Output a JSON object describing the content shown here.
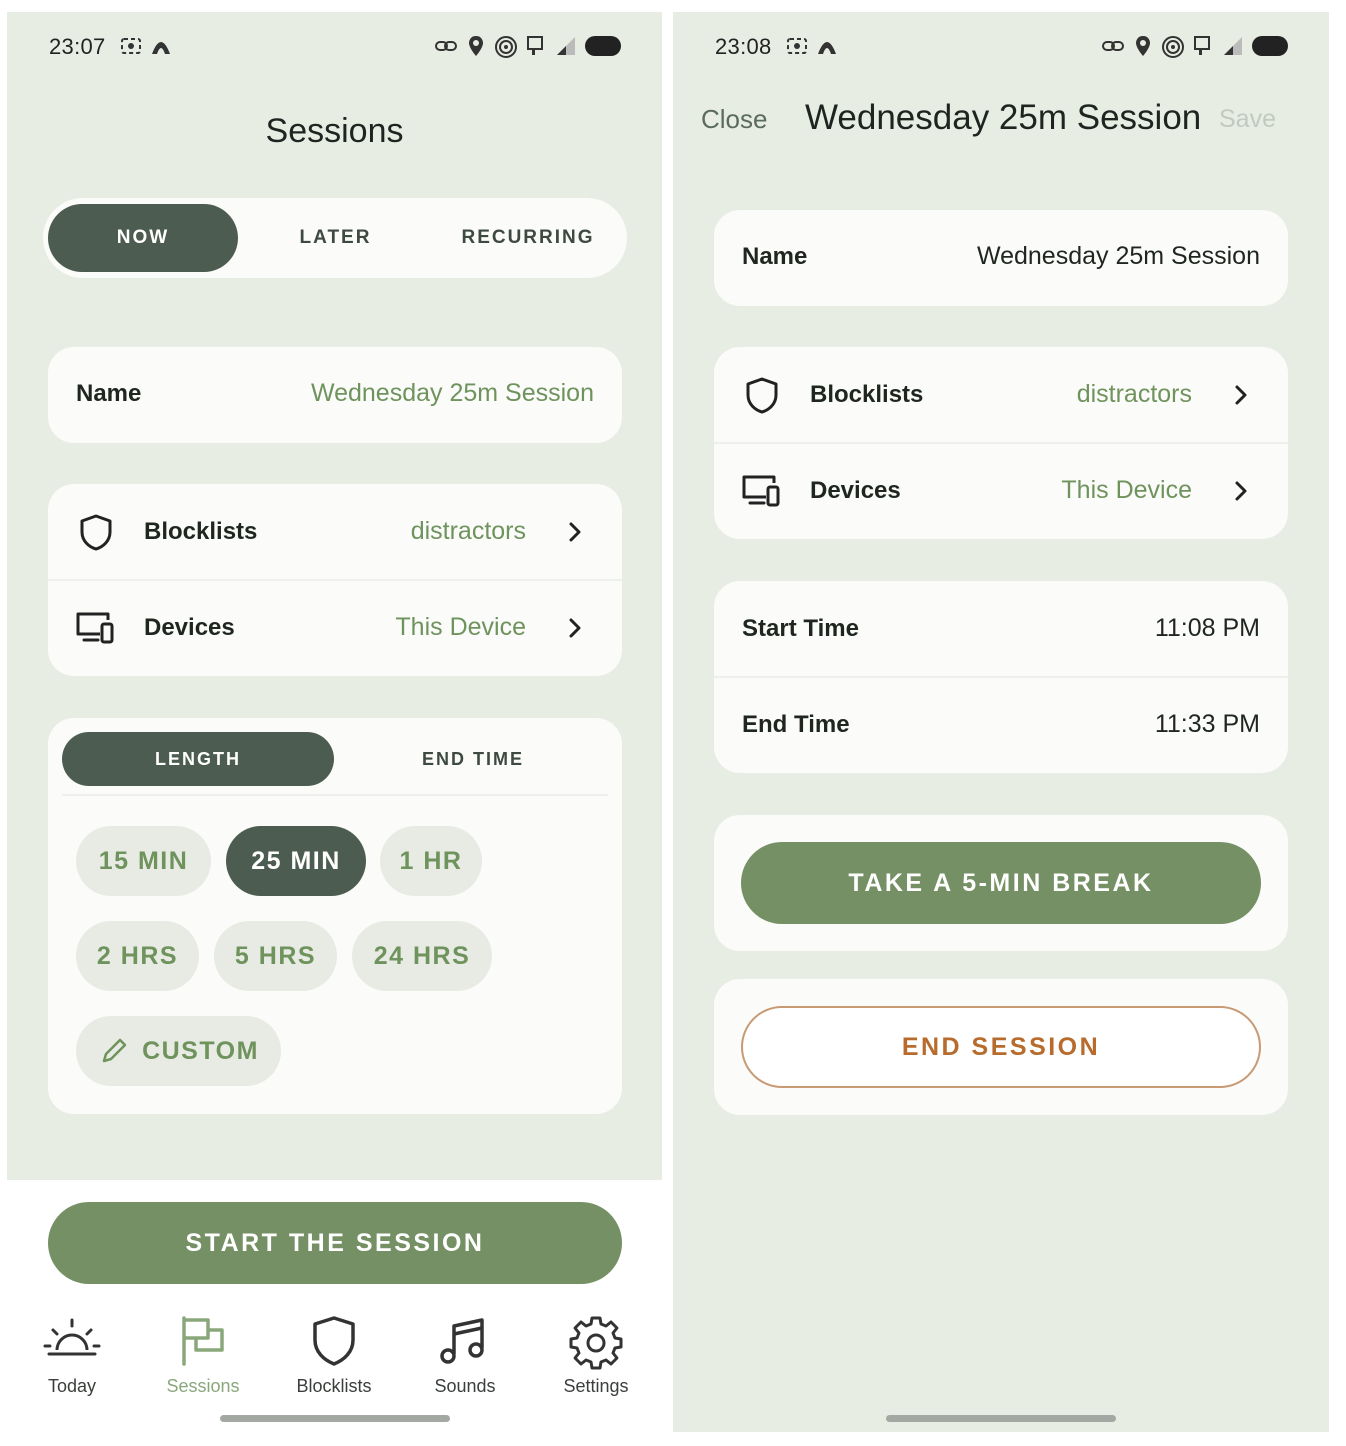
{
  "colors": {
    "accent": "#759064",
    "accent_text": "#6f935d",
    "dark_toggle": "#4d5c50",
    "background": "#e8ede4",
    "end_button": "#b76b2c"
  },
  "left": {
    "status": {
      "time": "23:07"
    },
    "title": "Sessions",
    "tabs": [
      "NOW",
      "LATER",
      "RECURRING"
    ],
    "name": {
      "label": "Name",
      "value": "Wednesday 25m Session"
    },
    "blocklists": {
      "label": "Blocklists",
      "value": "distractors",
      "icon": "shield-icon"
    },
    "devices": {
      "label": "Devices",
      "value": "This Device",
      "icon": "devices-icon"
    },
    "mode_tabs": [
      "LENGTH",
      "END TIME"
    ],
    "durations": [
      "15 MIN",
      "25 MIN",
      "1 HR",
      "2 HRS",
      "5 HRS",
      "24 HRS"
    ],
    "custom": "CUSTOM",
    "start_button": "START THE SESSION",
    "nav": [
      {
        "label": "Today",
        "icon": "sun-icon"
      },
      {
        "label": "Sessions",
        "icon": "flags-icon"
      },
      {
        "label": "Blocklists",
        "icon": "shield-icon"
      },
      {
        "label": "Sounds",
        "icon": "music-note-icon"
      },
      {
        "label": "Settings",
        "icon": "gear-icon"
      }
    ]
  },
  "right": {
    "status": {
      "time": "23:08"
    },
    "close": "Close",
    "title": "Wednesday 25m Session",
    "save": "Save",
    "name": {
      "label": "Name",
      "value": "Wednesday 25m Session"
    },
    "blocklists": {
      "label": "Blocklists",
      "value": "distractors"
    },
    "devices": {
      "label": "Devices",
      "value": "This Device"
    },
    "start_time": {
      "label": "Start Time",
      "value": "11:08 PM"
    },
    "end_time": {
      "label": "End Time",
      "value": "11:33 PM"
    },
    "break_button": "TAKE A 5-MIN BREAK",
    "end_button": "END SESSION"
  }
}
